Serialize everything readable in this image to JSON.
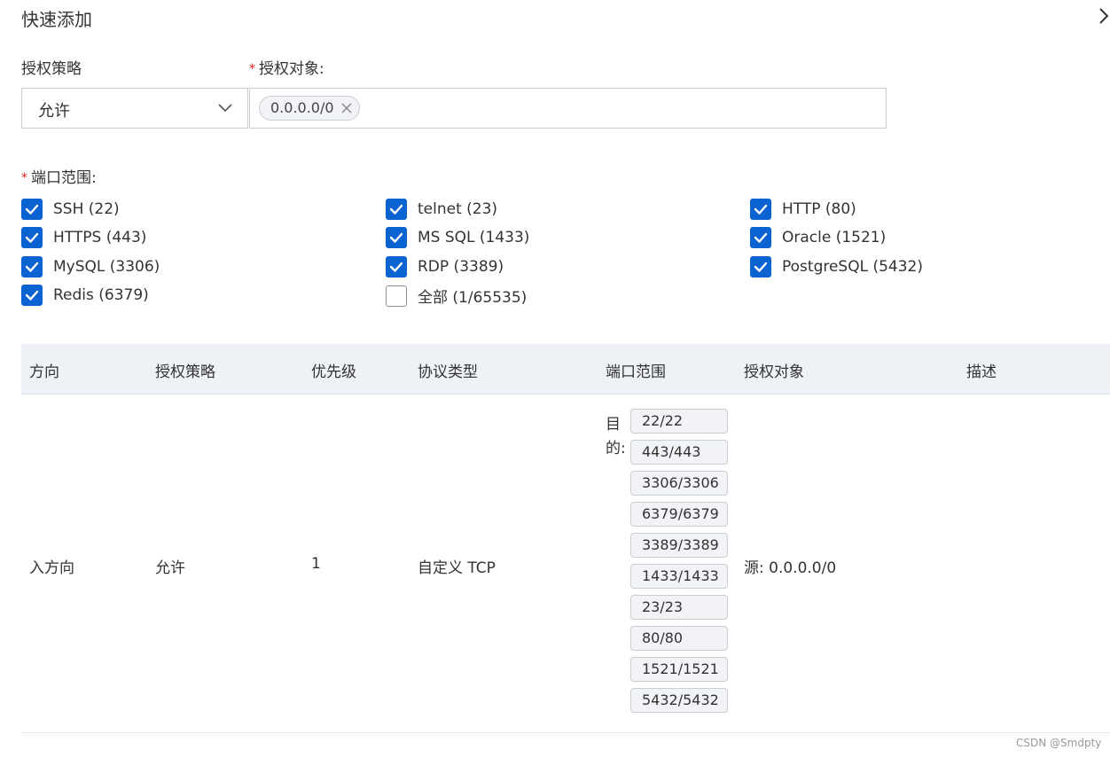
{
  "header": {
    "title": "快速添加",
    "collapse_icon": "chevron-right-icon"
  },
  "form": {
    "policy_label": "授权策略",
    "policy_value": "允许",
    "target_label": "授权对象:",
    "target_tag": "0.0.0.0/0",
    "ports_label": "端口范围:",
    "required_mark": "*"
  },
  "ports": [
    {
      "label": "SSH (22)",
      "checked": true
    },
    {
      "label": "telnet (23)",
      "checked": true
    },
    {
      "label": "HTTP (80)",
      "checked": true
    },
    {
      "label": "HTTPS (443)",
      "checked": true
    },
    {
      "label": "MS SQL (1433)",
      "checked": true
    },
    {
      "label": "Oracle (1521)",
      "checked": true
    },
    {
      "label": "MySQL (3306)",
      "checked": true
    },
    {
      "label": "RDP (3389)",
      "checked": true
    },
    {
      "label": "PostgreSQL (5432)",
      "checked": true
    },
    {
      "label": "Redis (6379)",
      "checked": true
    },
    {
      "label": "全部 (1/65535)",
      "checked": false
    }
  ],
  "table": {
    "headers": [
      "方向",
      "授权策略",
      "优先级",
      "协议类型",
      "端口范围",
      "授权对象",
      "描述"
    ],
    "row": {
      "direction": "入方向",
      "policy": "允许",
      "priority": "1",
      "protocol": "自定义 TCP",
      "dest_prefix_1": "目",
      "dest_prefix_2": "的:",
      "port_ranges": [
        "22/22",
        "443/443",
        "3306/3306",
        "6379/6379",
        "3389/3389",
        "1433/1433",
        "23/23",
        "80/80",
        "1521/1521",
        "5432/5432"
      ],
      "target": "源: 0.0.0.0/0",
      "description": ""
    }
  },
  "watermark": "CSDN @Smdpty",
  "colors": {
    "accent": "#0a63d0",
    "header_bg": "#eef1f5",
    "required": "#e2231a"
  }
}
